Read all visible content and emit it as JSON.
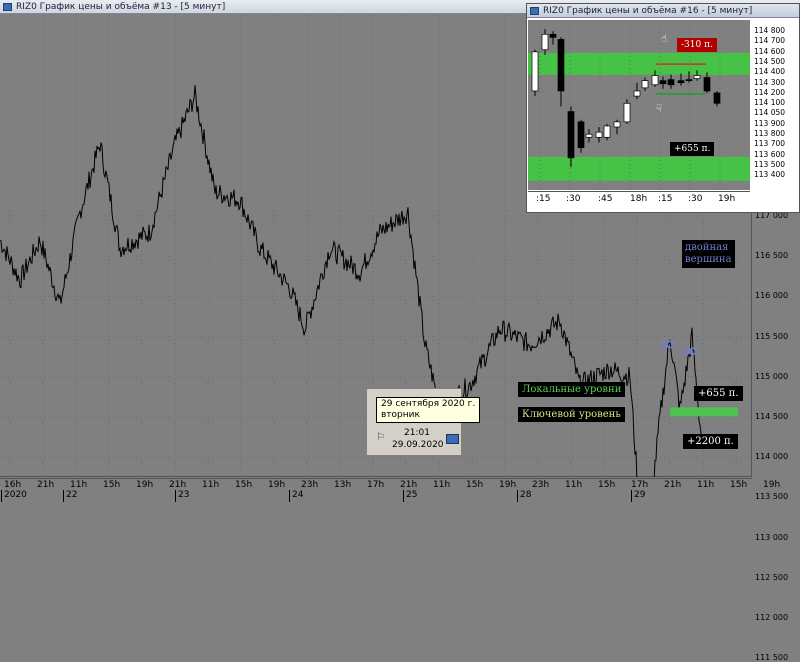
{
  "main_window": {
    "title": "RIZ0 График цены и объёма #13 - [5 минут]",
    "price_axis": [
      "117 000",
      "116 500",
      "116 000",
      "115 500",
      "115 000",
      "114 500",
      "114 000",
      "113 500",
      "113 000",
      "112 500",
      "112 000",
      "111 500"
    ],
    "time_axis_top": [
      "16h",
      "21h",
      "11h",
      "15h",
      "19h",
      "21h",
      "11h",
      "15h",
      "19h",
      "23h",
      "13h",
      "17h",
      "21h",
      "11h",
      "15h",
      "19h",
      "23h",
      "11h",
      "15h",
      "17h",
      "21h",
      "11h",
      "15h",
      "19h"
    ],
    "date_axis": [
      "2020",
      "22",
      "23",
      "24",
      "25",
      "28",
      "29"
    ],
    "labels": {
      "double_top": "двойная\nвершина",
      "local_levels": "Локальные уровни",
      "key_level": "Ключевой уровень",
      "gain_small": "+655 п.",
      "gain_large": "+2200 п."
    },
    "tooltip": {
      "date": "29 сентября 2020 г.",
      "weekday": "вторник"
    },
    "date_box": {
      "time": "21:01",
      "date": "29.09.2020"
    },
    "colors": {
      "level_green": "#4ec24e",
      "key_level": "#d8d86c",
      "ann_bg": "#000000",
      "local_text": "#5bd15b",
      "key_text": "#e0e08a",
      "double_top_text": "#6f7fd8",
      "double_top_marker": "#6f7fd8"
    }
  },
  "inset_window": {
    "title": "RIZ0 График цены и объёма #16 - [5 минут]",
    "price_axis": [
      "114 800",
      "114 700",
      "114 600",
      "114 500",
      "114 400",
      "114 300",
      "114 200",
      "114 100",
      "114 050",
      "113 900",
      "113 800",
      "113 700",
      "113 600",
      "113 500",
      "113 400"
    ],
    "time_axis": [
      ":15",
      ":30",
      ":45",
      "18h",
      ":15",
      ":30",
      "19h"
    ],
    "labels": {
      "loss": "-310 п.",
      "gain": "+655 п."
    },
    "colors": {
      "band": "#46c246",
      "loss_bg": "#b00000",
      "gain_bg": "#000000",
      "stop_line": "#d03030",
      "target_line": "#20a020"
    }
  }
}
